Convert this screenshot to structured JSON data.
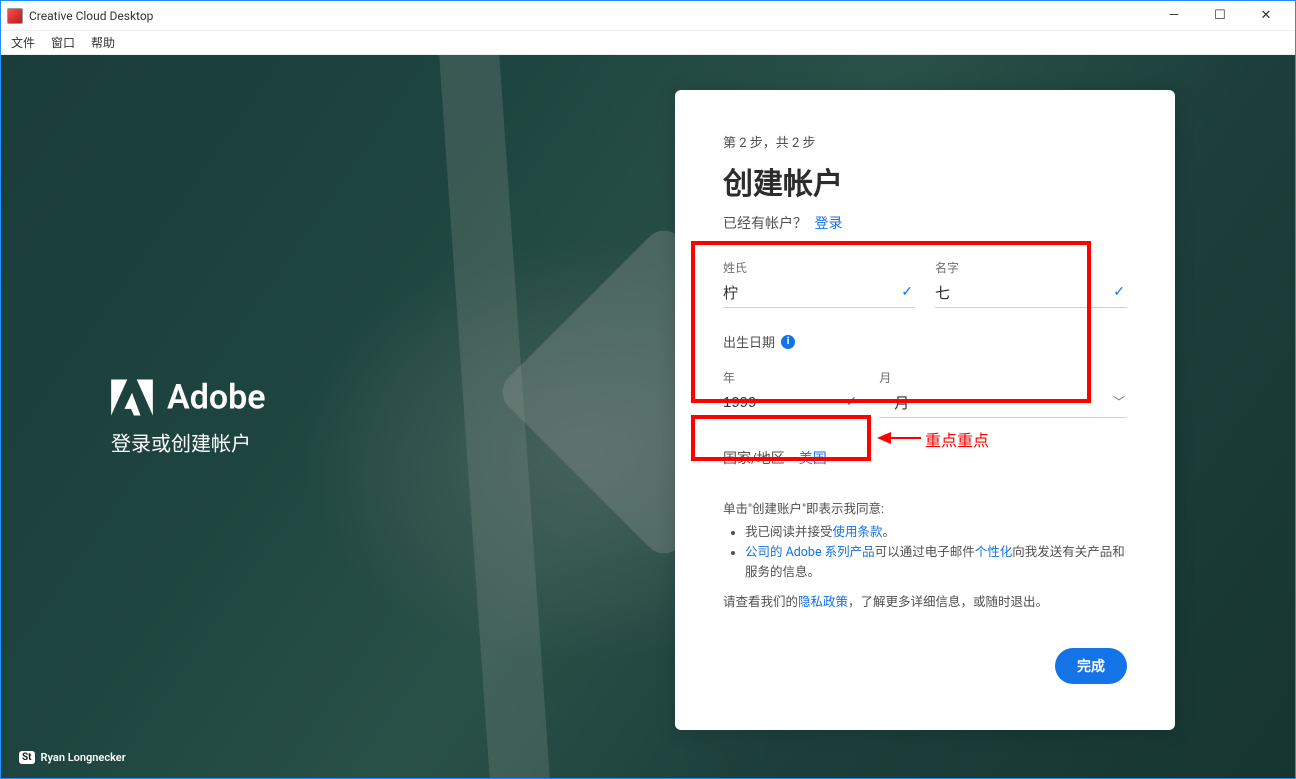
{
  "window": {
    "title": "Creative Cloud Desktop"
  },
  "menubar": {
    "file": "文件",
    "window": "窗口",
    "help": "帮助"
  },
  "brand": {
    "name": "Adobe",
    "subtitle": "登录或创建帐户"
  },
  "credit": {
    "badge": "St",
    "author": "Ryan Longnecker"
  },
  "form": {
    "step": "第 2 步，共 2 步",
    "title": "创建帐户",
    "already_prefix": "已经有帐户？",
    "signin_link": "登录",
    "lastname_label": "姓氏",
    "lastname_value": "柠",
    "firstname_label": "名字",
    "firstname_value": "七",
    "dob_label": "出生日期",
    "year_label": "年",
    "year_value": "1999",
    "month_label": "月",
    "month_value": "一月",
    "region_label": "国家/地区",
    "region_value": "美国",
    "terms_intro": "单击\"创建账户\"即表示我同意:",
    "terms_item1_prefix": "我已阅读并接受",
    "terms_item1_link": "使用条款",
    "terms_item1_suffix": "。",
    "terms_item2_link1": "公司的 Adobe 系列产品",
    "terms_item2_mid": "可以通过电子邮件",
    "terms_item2_link2": "个性化",
    "terms_item2_suffix": "向我发送有关产品和服务的信息。",
    "terms_footer_prefix": "请查看我们的",
    "terms_footer_link": "隐私政策",
    "terms_footer_suffix": "，了解更多详细信息，或随时退出。",
    "done_button": "完成"
  },
  "annotation": {
    "text": "重点重点"
  }
}
